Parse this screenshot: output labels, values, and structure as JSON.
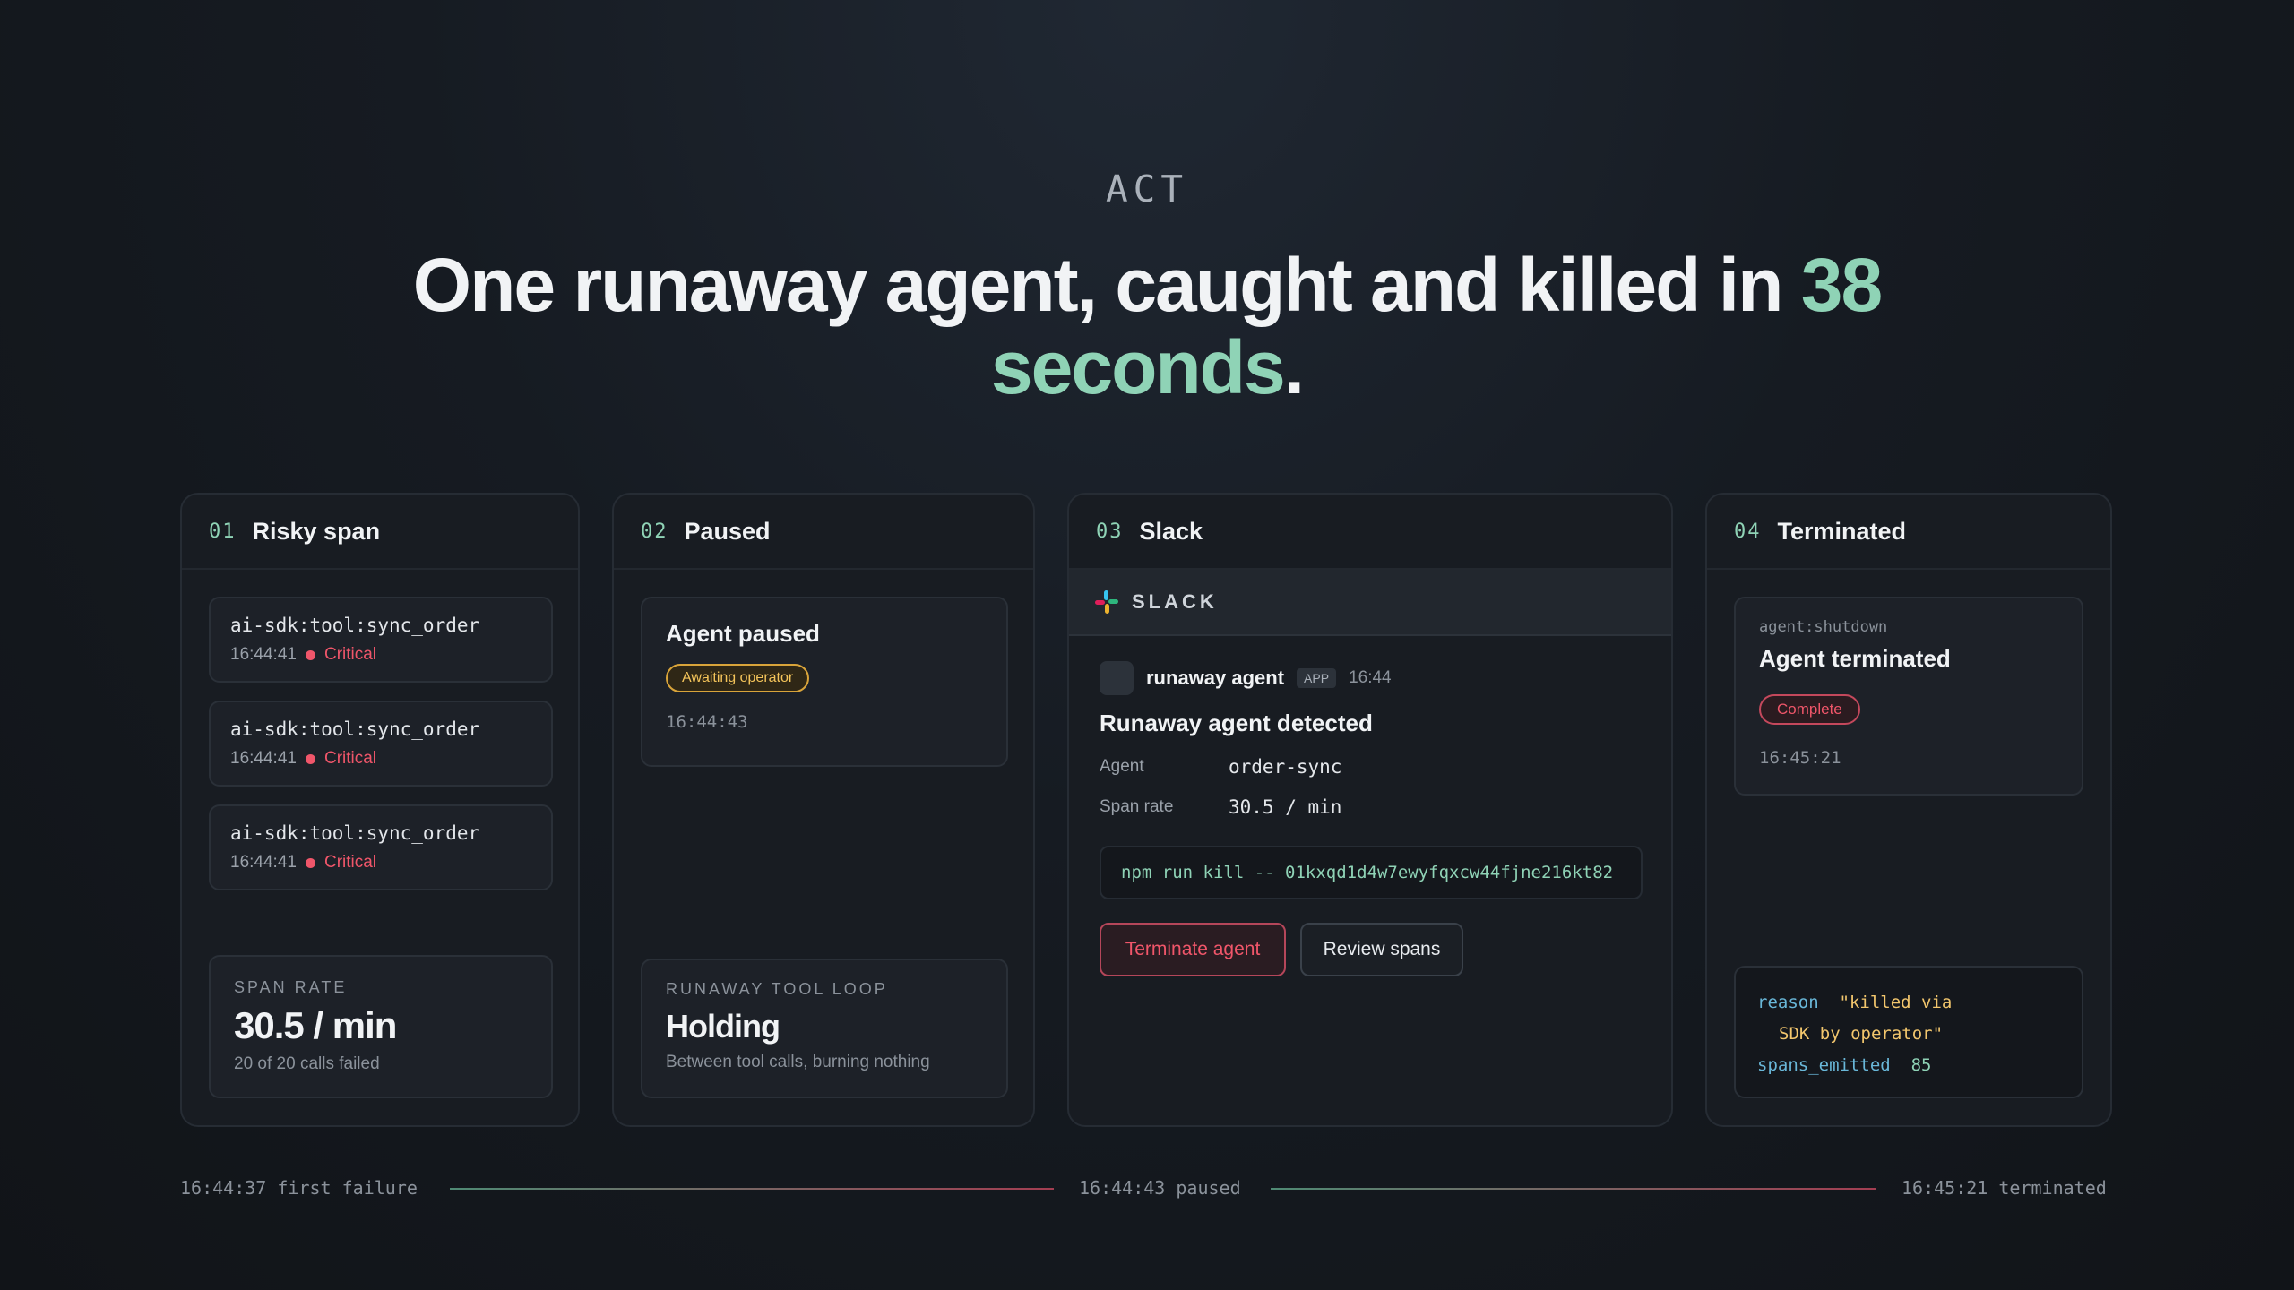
{
  "eyebrow": "ACT",
  "headline": {
    "main": "One runaway agent, caught and killed in ",
    "accent": "38 seconds",
    "end": "."
  },
  "cards": [
    {
      "num": "01",
      "title": "Risky span",
      "spans": [
        {
          "name": "ai-sdk:tool:sync_order",
          "time": "16:44:41",
          "severity": "Critical"
        },
        {
          "name": "ai-sdk:tool:sync_order",
          "time": "16:44:41",
          "severity": "Critical"
        },
        {
          "name": "ai-sdk:tool:sync_order",
          "time": "16:44:41",
          "severity": "Critical"
        }
      ],
      "metric": {
        "label": "SPAN RATE",
        "value": "30.5 / min",
        "sub": "20 of 20 calls failed"
      }
    },
    {
      "num": "02",
      "title": "Paused",
      "status": {
        "title": "Agent paused",
        "badge": "Awaiting operator",
        "time": "16:44:43"
      },
      "metric": {
        "label": "RUNAWAY TOOL LOOP",
        "value": "Holding",
        "sub": "Between tool calls, burning nothing"
      }
    },
    {
      "num": "03",
      "title": "Slack",
      "slack_label": "SLACK",
      "message": {
        "sender": "runaway agent",
        "tag": "APP",
        "time": "16:44",
        "title": "Runaway agent detected",
        "fields": [
          {
            "key": "Agent",
            "value": "order-sync"
          },
          {
            "key": "Span rate",
            "value": "30.5 / min"
          }
        ],
        "command": "npm run kill -- 01kxqd1d4w7ewyfqxcw44fjne216kt82",
        "terminate_label": "Terminate agent",
        "review_label": "Review spans"
      }
    },
    {
      "num": "04",
      "title": "Terminated",
      "status": {
        "event": "agent:shutdown",
        "title": "Agent terminated",
        "badge": "Complete",
        "time": "16:45:21"
      },
      "log": {
        "reason_key": "reason",
        "reason_val_1": "\"killed via",
        "reason_val_2": "SDK by operator\"",
        "spans_key": "spans_emitted",
        "spans_val": "85"
      }
    }
  ],
  "timeline": {
    "start": "16:44:37 first failure",
    "mid": "16:44:43 paused",
    "end": "16:45:21 terminated"
  },
  "colors": {
    "accent": "#8fd3b6",
    "critical": "#f0566a",
    "amber": "#f4c45a"
  }
}
